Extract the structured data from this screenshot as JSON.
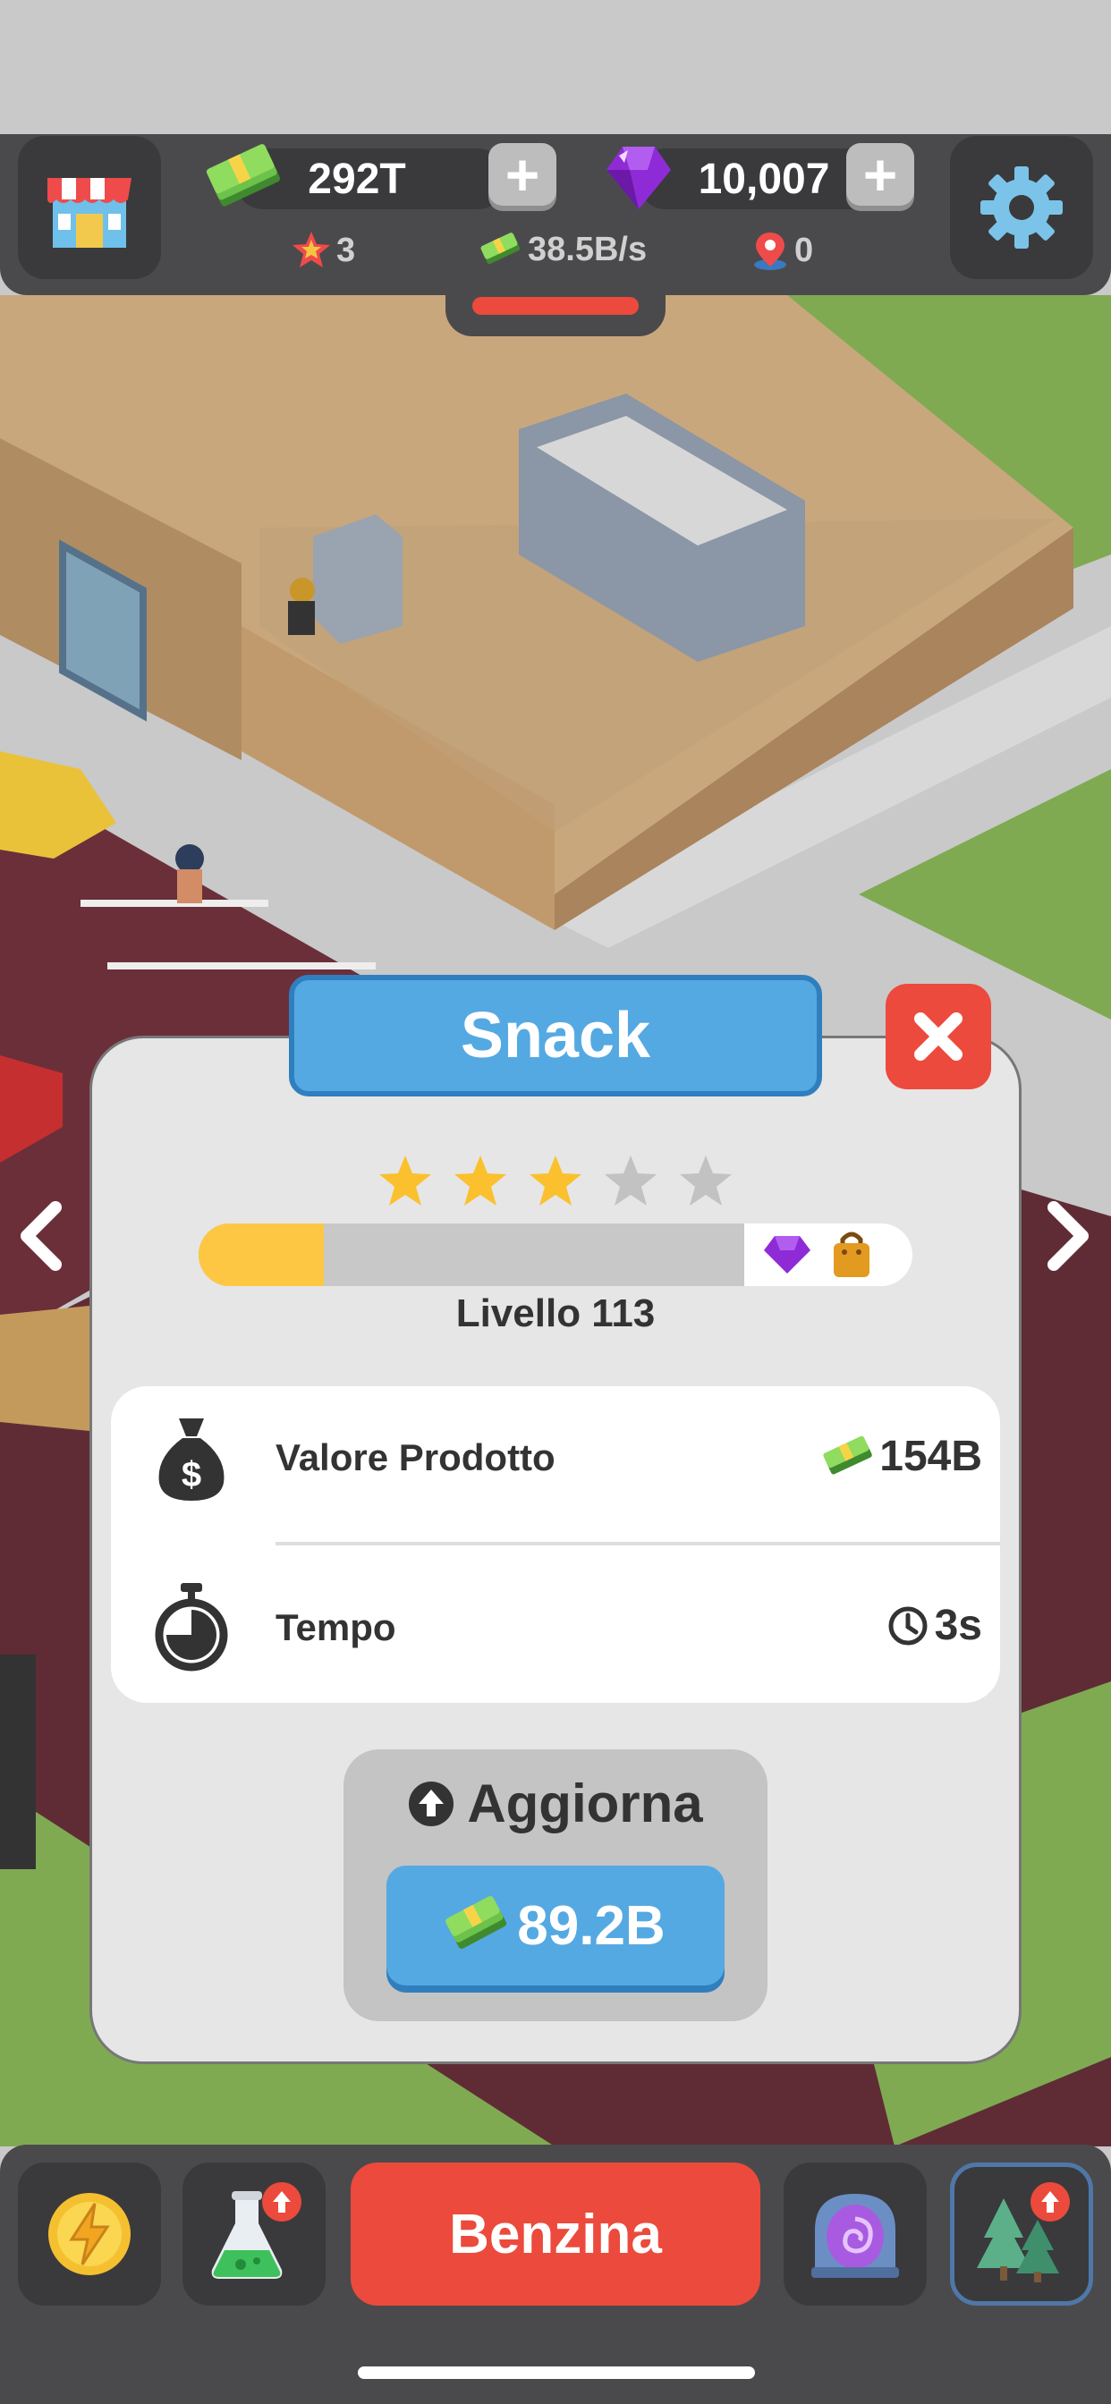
{
  "top_bar": {
    "cash": "292T",
    "gems": "10,007",
    "stars": "3",
    "income_rate": "38.5B/s",
    "locations": "0"
  },
  "dialog": {
    "title": "Snack",
    "stars_filled": 3,
    "stars_total": 5,
    "progress_fraction": 0.23,
    "level_label": "Livello 113",
    "rows": [
      {
        "label": "Valore Prodotto",
        "value": "154B",
        "icon": "money-bag-icon",
        "value_icon": "cash-icon"
      },
      {
        "label": "Tempo",
        "value": "3s",
        "icon": "stopwatch-icon",
        "value_icon": "clock-icon"
      }
    ],
    "upgrade": {
      "title": "Aggiorna",
      "price": "89.2B"
    }
  },
  "bottom_bar": {
    "main_button": "Benzina",
    "items": [
      "boost-icon",
      "research-icon",
      "portal-icon",
      "trees-icon"
    ]
  },
  "colors": {
    "accent_blue": "#55a9e2",
    "danger_red": "#ec4a3c",
    "progress_yellow": "#fdc743",
    "star_gold": "#fbc02d",
    "gem_purple": "#8e2bd6"
  }
}
